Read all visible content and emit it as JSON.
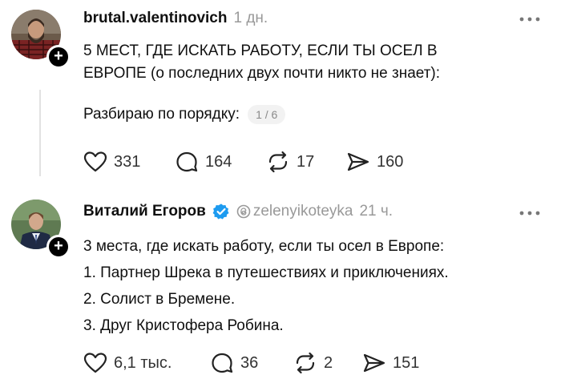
{
  "posts": [
    {
      "username": "brutal.valentinovich",
      "time": "1 дн.",
      "lines": [
        "5 МЕСТ, ГДЕ ИСКАТЬ РАБОТУ, ЕСЛИ ТЫ ОСЕЛ В",
        "ЕВРОПЕ (о последних двух почти никто не знает):"
      ],
      "subline": "Разбираю по порядку:",
      "counter": "1 / 6",
      "actions": {
        "likes": "331",
        "comments": "164",
        "reposts": "17",
        "shares": "160"
      }
    },
    {
      "username": "Виталий Егоров",
      "handle": "zelenyikoteyka",
      "time": "21 ч.",
      "lines": [
        "3 места, где искать работу, если ты осел в Европе:",
        "1. Партнер Шрека в путешествиях и приключениях.",
        "2. Солист в Бремене.",
        "3. Друг Кристофера Робина."
      ],
      "actions": {
        "likes": "6,1 тыс.",
        "comments": "36",
        "reposts": "2",
        "shares": "151"
      }
    }
  ],
  "icons": {
    "follow": "+",
    "like": "heart-icon",
    "comment": "comment-icon",
    "repost": "repost-icon",
    "share": "share-icon",
    "more": "more-icon",
    "verified": "verified-icon",
    "threads": "threads-icon"
  },
  "colors": {
    "verified": "#1d9bf0",
    "muted": "#999999"
  }
}
